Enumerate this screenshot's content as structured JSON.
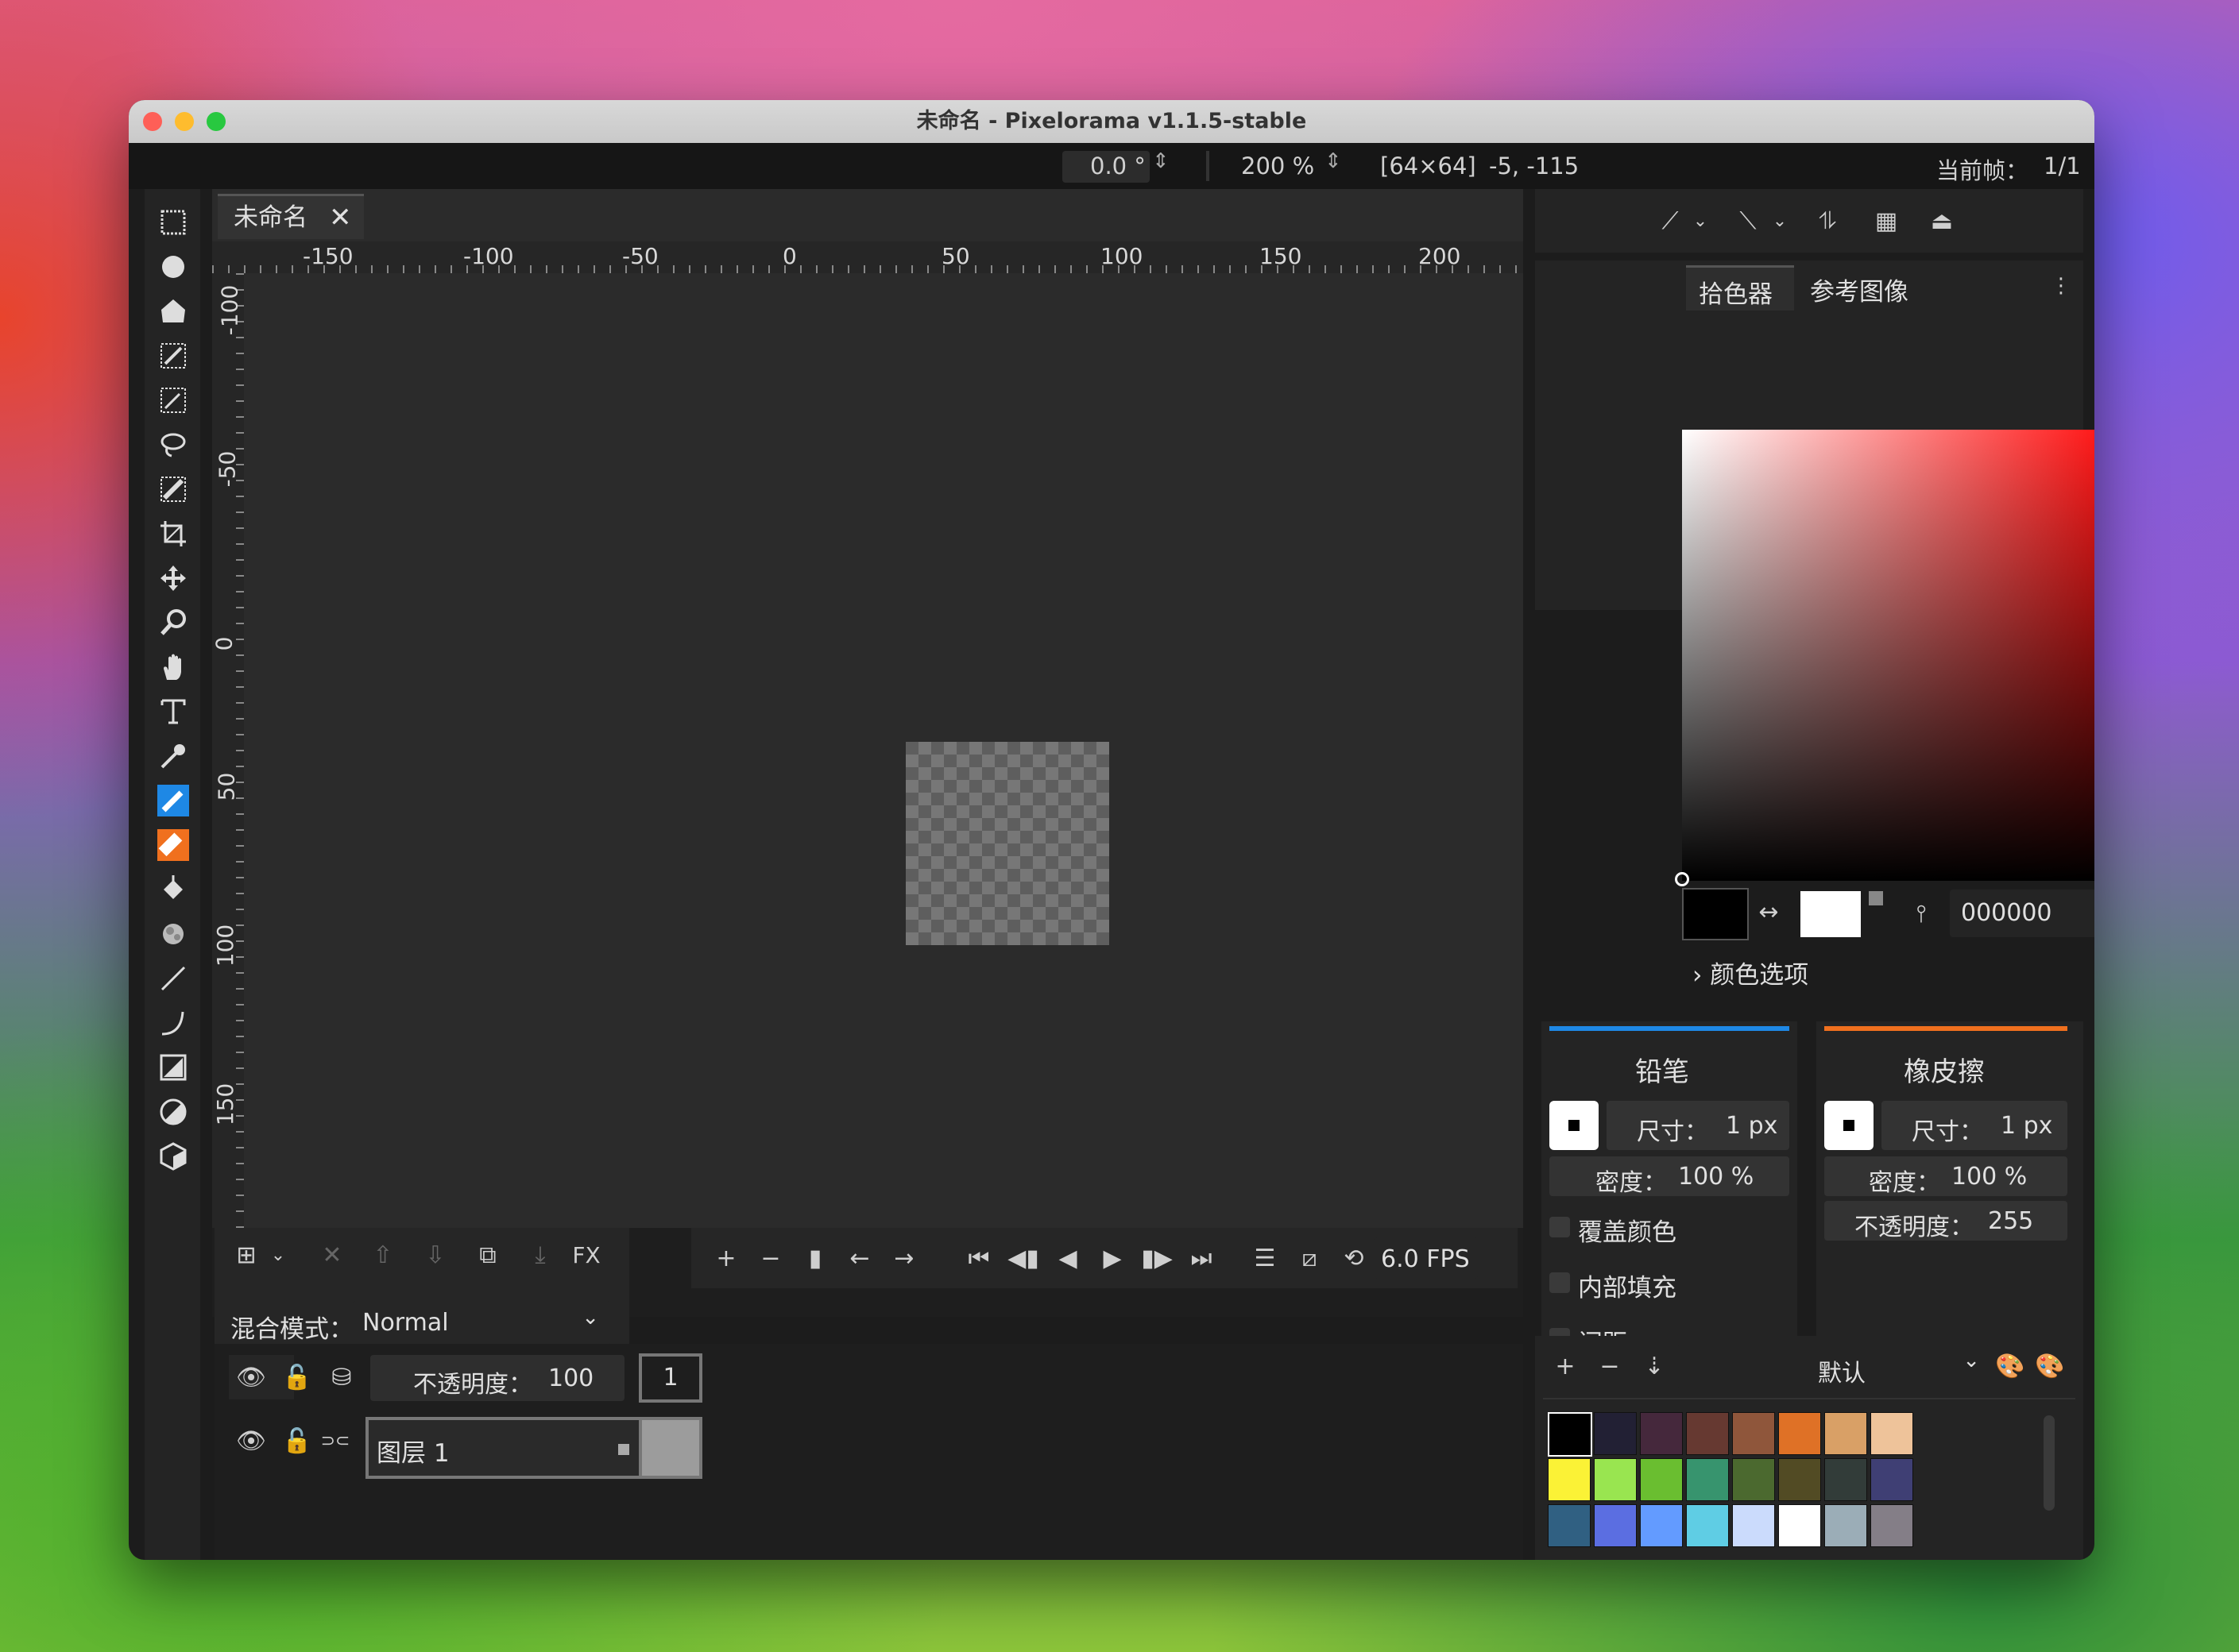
{
  "window": {
    "title": "未命名 - Pixelorama v1.1.5-stable"
  },
  "topbar": {
    "rotation": "0.0 °",
    "zoom": "200 %",
    "canvas_size": "[64×64]",
    "cursor_pos": "-5, -115",
    "frame_label": "当前帧：",
    "frame_value": "1/1"
  },
  "tools": [
    "rectangle-select",
    "ellipse-select",
    "polygon-select",
    "color-select",
    "magic-wand",
    "lasso",
    "paint-select",
    "crop",
    "move",
    "zoom",
    "pan",
    "text",
    "color-picker",
    "pencil",
    "eraser",
    "bucket",
    "shading",
    "line",
    "curve",
    "rectangle",
    "ellipse",
    "3d-shape"
  ],
  "canvas_tab": {
    "label": "未命名"
  },
  "rulers": {
    "h_labels": [
      "-150",
      "-100",
      "-50",
      "0",
      "50",
      "100",
      "150",
      "200"
    ],
    "v_labels": [
      "-100",
      "-50",
      "0",
      "50",
      "100",
      "150"
    ]
  },
  "layers": {
    "blend_label": "混合模式：",
    "blend_value": "Normal",
    "opacity_label": "不透明度：",
    "opacity_value": "100",
    "frame_number": "1",
    "layer_name": "图层 1",
    "fx_label": "FX"
  },
  "animation": {
    "fps": "6.0 FPS"
  },
  "color_panel": {
    "tab_picker": "拾色器",
    "tab_reference": "参考图像",
    "hex": "000000",
    "options_label": "颜色选项"
  },
  "pencil": {
    "title": "铅笔",
    "size_label": "尺寸：",
    "size_value": "1 px",
    "density_label": "密度：",
    "density_value": "100 %",
    "overwrite": "覆盖颜色",
    "fill_inside": "内部填充",
    "spacing": "间距",
    "accent": "#1e88e5"
  },
  "eraser": {
    "title": "橡皮擦",
    "size_label": "尺寸：",
    "size_value": "1 px",
    "density_label": "密度：",
    "density_value": "100 %",
    "opacity_label": "不透明度：",
    "opacity_value": "255",
    "accent": "#f0701e"
  },
  "palette": {
    "name": "默认",
    "colors": [
      "#000000",
      "#222034",
      "#45283c",
      "#663931",
      "#8f563b",
      "#df7126",
      "#d9a066",
      "#eec39a",
      "#fbf236",
      "#99e550",
      "#6abe30",
      "#37946e",
      "#4b692f",
      "#524b24",
      "#323c39",
      "#3f3f74",
      "#306082",
      "#5b6ee1",
      "#639bff",
      "#5fcde4",
      "#cbdbfc",
      "#ffffff",
      "#9badb7",
      "#847e87"
    ]
  }
}
